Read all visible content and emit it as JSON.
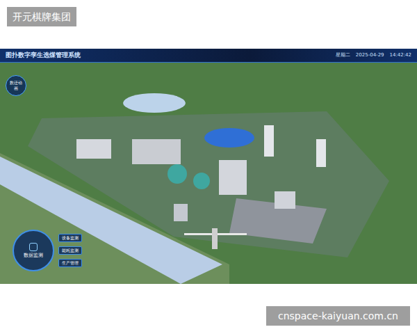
{
  "watermark": {
    "text": "开元棋牌集团"
  },
  "dashboard": {
    "title": "图扑数字孪生选煤管理系统",
    "weekday": "星期二",
    "date": "2025-04-29",
    "time": "14:42:42",
    "animation_button": "数迁动画",
    "menu": {
      "center": "数据监测",
      "items": [
        "设备监测",
        "能耗监测",
        "生产管理"
      ]
    }
  },
  "footer": {
    "text": "cnspace-kaiyuan.com.cn"
  }
}
